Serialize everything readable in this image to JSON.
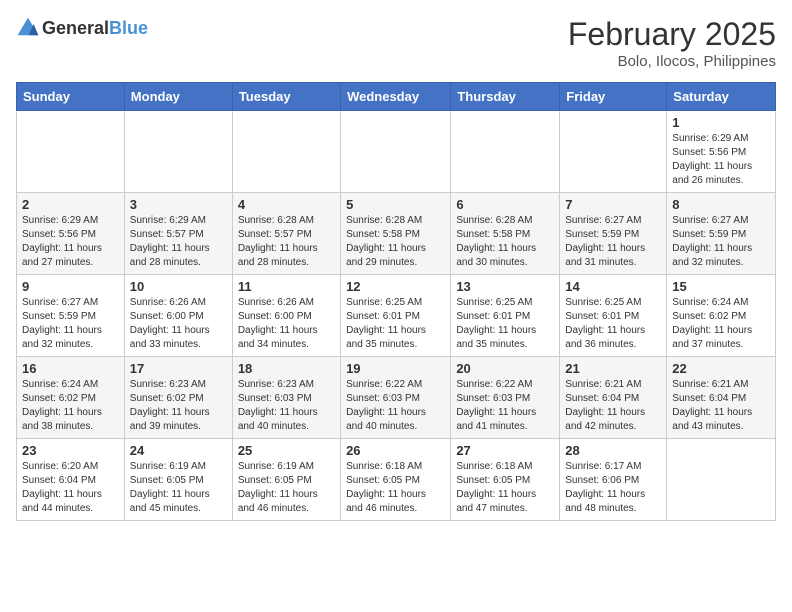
{
  "header": {
    "logo": {
      "general": "General",
      "blue": "Blue"
    },
    "title": "February 2025",
    "location": "Bolo, Ilocos, Philippines"
  },
  "calendar": {
    "days_of_week": [
      "Sunday",
      "Monday",
      "Tuesday",
      "Wednesday",
      "Thursday",
      "Friday",
      "Saturday"
    ],
    "weeks": [
      [
        {
          "day": "",
          "content": ""
        },
        {
          "day": "",
          "content": ""
        },
        {
          "day": "",
          "content": ""
        },
        {
          "day": "",
          "content": ""
        },
        {
          "day": "",
          "content": ""
        },
        {
          "day": "",
          "content": ""
        },
        {
          "day": "1",
          "content": "Sunrise: 6:29 AM\nSunset: 5:56 PM\nDaylight: 11 hours and 26 minutes."
        }
      ],
      [
        {
          "day": "2",
          "content": "Sunrise: 6:29 AM\nSunset: 5:56 PM\nDaylight: 11 hours and 27 minutes."
        },
        {
          "day": "3",
          "content": "Sunrise: 6:29 AM\nSunset: 5:57 PM\nDaylight: 11 hours and 28 minutes."
        },
        {
          "day": "4",
          "content": "Sunrise: 6:28 AM\nSunset: 5:57 PM\nDaylight: 11 hours and 28 minutes."
        },
        {
          "day": "5",
          "content": "Sunrise: 6:28 AM\nSunset: 5:58 PM\nDaylight: 11 hours and 29 minutes."
        },
        {
          "day": "6",
          "content": "Sunrise: 6:28 AM\nSunset: 5:58 PM\nDaylight: 11 hours and 30 minutes."
        },
        {
          "day": "7",
          "content": "Sunrise: 6:27 AM\nSunset: 5:59 PM\nDaylight: 11 hours and 31 minutes."
        },
        {
          "day": "8",
          "content": "Sunrise: 6:27 AM\nSunset: 5:59 PM\nDaylight: 11 hours and 32 minutes."
        }
      ],
      [
        {
          "day": "9",
          "content": "Sunrise: 6:27 AM\nSunset: 5:59 PM\nDaylight: 11 hours and 32 minutes."
        },
        {
          "day": "10",
          "content": "Sunrise: 6:26 AM\nSunset: 6:00 PM\nDaylight: 11 hours and 33 minutes."
        },
        {
          "day": "11",
          "content": "Sunrise: 6:26 AM\nSunset: 6:00 PM\nDaylight: 11 hours and 34 minutes."
        },
        {
          "day": "12",
          "content": "Sunrise: 6:25 AM\nSunset: 6:01 PM\nDaylight: 11 hours and 35 minutes."
        },
        {
          "day": "13",
          "content": "Sunrise: 6:25 AM\nSunset: 6:01 PM\nDaylight: 11 hours and 35 minutes."
        },
        {
          "day": "14",
          "content": "Sunrise: 6:25 AM\nSunset: 6:01 PM\nDaylight: 11 hours and 36 minutes."
        },
        {
          "day": "15",
          "content": "Sunrise: 6:24 AM\nSunset: 6:02 PM\nDaylight: 11 hours and 37 minutes."
        }
      ],
      [
        {
          "day": "16",
          "content": "Sunrise: 6:24 AM\nSunset: 6:02 PM\nDaylight: 11 hours and 38 minutes."
        },
        {
          "day": "17",
          "content": "Sunrise: 6:23 AM\nSunset: 6:02 PM\nDaylight: 11 hours and 39 minutes."
        },
        {
          "day": "18",
          "content": "Sunrise: 6:23 AM\nSunset: 6:03 PM\nDaylight: 11 hours and 40 minutes."
        },
        {
          "day": "19",
          "content": "Sunrise: 6:22 AM\nSunset: 6:03 PM\nDaylight: 11 hours and 40 minutes."
        },
        {
          "day": "20",
          "content": "Sunrise: 6:22 AM\nSunset: 6:03 PM\nDaylight: 11 hours and 41 minutes."
        },
        {
          "day": "21",
          "content": "Sunrise: 6:21 AM\nSunset: 6:04 PM\nDaylight: 11 hours and 42 minutes."
        },
        {
          "day": "22",
          "content": "Sunrise: 6:21 AM\nSunset: 6:04 PM\nDaylight: 11 hours and 43 minutes."
        }
      ],
      [
        {
          "day": "23",
          "content": "Sunrise: 6:20 AM\nSunset: 6:04 PM\nDaylight: 11 hours and 44 minutes."
        },
        {
          "day": "24",
          "content": "Sunrise: 6:19 AM\nSunset: 6:05 PM\nDaylight: 11 hours and 45 minutes."
        },
        {
          "day": "25",
          "content": "Sunrise: 6:19 AM\nSunset: 6:05 PM\nDaylight: 11 hours and 46 minutes."
        },
        {
          "day": "26",
          "content": "Sunrise: 6:18 AM\nSunset: 6:05 PM\nDaylight: 11 hours and 46 minutes."
        },
        {
          "day": "27",
          "content": "Sunrise: 6:18 AM\nSunset: 6:05 PM\nDaylight: 11 hours and 47 minutes."
        },
        {
          "day": "28",
          "content": "Sunrise: 6:17 AM\nSunset: 6:06 PM\nDaylight: 11 hours and 48 minutes."
        },
        {
          "day": "",
          "content": ""
        }
      ]
    ]
  }
}
